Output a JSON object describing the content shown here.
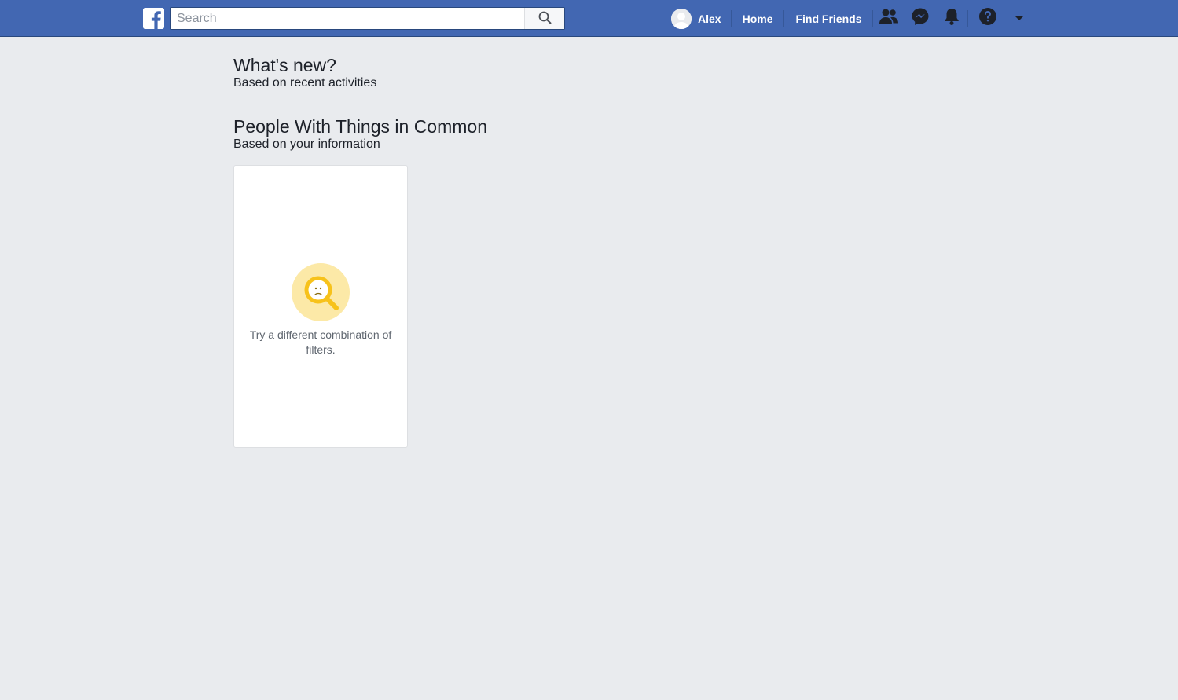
{
  "header": {
    "logo": "facebook-f-logo",
    "search": {
      "placeholder": "Search",
      "value": "",
      "icon": "search-icon"
    },
    "profile_name": "Alex",
    "nav_home": "Home",
    "nav_find_friends": "Find Friends",
    "icons": [
      "friend-requests-icon",
      "messenger-icon",
      "notifications-icon",
      "help-icon",
      "account-menu-caret-icon"
    ],
    "brand_color": "#4267b2"
  },
  "sections": {
    "whats_new": {
      "title": "What's new?",
      "subtitle": "Based on recent activities"
    },
    "people_common": {
      "title": "People With Things in Common",
      "subtitle": "Based on your information"
    }
  },
  "empty_card": {
    "icon": "sad-magnifier-icon",
    "message": "Try a different combination of filters."
  }
}
